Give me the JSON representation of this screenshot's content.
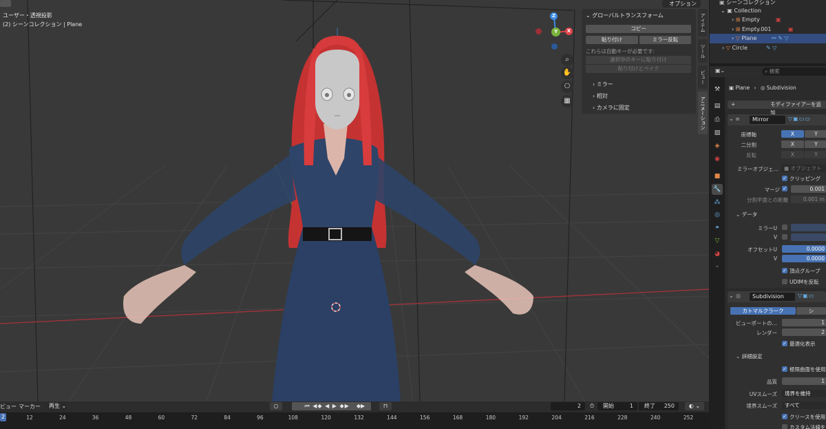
{
  "viewport": {
    "view_mode": "ユーザー・透視投影",
    "collection_info": "(2) シーンコレクション | Plane",
    "options_label": "オプション",
    "gizmo": {
      "z": "Z",
      "y": "Y",
      "x": "X"
    }
  },
  "npanel": {
    "title": "グローバルトランスフォーム",
    "copy": "コピー",
    "paste": "貼り付け",
    "mirror_flip": "ミラー反転",
    "auto_key_note": "これらは自動キーが必要です:",
    "paste_selected": "選択中のキーに貼り付け",
    "paste_bake": "貼り付けとベイク",
    "sub_mirror": "ミラー",
    "sub_relative": "相対",
    "sub_camera": "カメラに固定",
    "tabs": [
      "アイテム",
      "ツール",
      "ビュー",
      "アニメーション"
    ]
  },
  "timeline": {
    "menu_view": "ビュー",
    "menu_marker": "マーカー",
    "menu_play": "再生",
    "current_frame": "2",
    "start_label": "開始",
    "start_value": "1",
    "end_label": "終了",
    "end_value": "250",
    "cursor_label": "2",
    "ticks": [
      "12",
      "24",
      "36",
      "48",
      "60",
      "72",
      "84",
      "96",
      "108",
      "120",
      "132",
      "144",
      "156",
      "168",
      "180",
      "192",
      "204",
      "216",
      "228",
      "240",
      "252"
    ]
  },
  "outliner": {
    "root": "シーンコレクション",
    "collection": "Collection",
    "items": [
      "Empty",
      "Empty.001",
      "Plane",
      "Circle"
    ]
  },
  "properties": {
    "search_placeholder": "検索",
    "breadcrumb_object": "Plane",
    "breadcrumb_modifier": "Subdivision",
    "add_modifier": "モディファイアーを追加",
    "mirror": {
      "name": "Mirror",
      "axis_label": "座標軸",
      "bisect_label": "二分割",
      "flip_label": "反転",
      "x": "X",
      "y": "Y",
      "mirror_object_label": "ミラーオブジェ…",
      "mirror_object_placeholder": "オブジェクト",
      "clipping": "クリッピング",
      "merge_label": "マージ",
      "merge_value": "0.001",
      "bisect_distance_label": "分割平面との距離",
      "bisect_distance_value": "0.001 m",
      "data_label": "データ",
      "mirror_u": "ミラーU",
      "v": "V",
      "offset_u": "オフセットU",
      "offset_u_value": "0.0000",
      "offset_v_value": "0.0000",
      "vertex_groups": "頂点グループ",
      "udim_flip": "UDIMを反転"
    },
    "subdivision": {
      "name": "Subdivision",
      "catmull": "カトマルクラーク",
      "simple": "シ",
      "viewport_label": "ビューポートの…",
      "viewport_value": "1",
      "render_label": "レンダー",
      "render_value": "2",
      "optimal_display": "最適化表示",
      "advanced": "詳細設定",
      "limit_surface": "極限曲面を使用",
      "quality_label": "品質",
      "quality_value": "1",
      "uv_smooth_label": "UVスムーズ",
      "uv_smooth_value": "境界を維持",
      "boundary_smooth_label": "境界スムーズ",
      "boundary_smooth_value": "すべて",
      "use_creases": "クリースを使用",
      "custom_normals": "カスタム法線を"
    }
  },
  "colors": {
    "viewport_bg": "#393939",
    "accent": "#4772b3",
    "hair": "#d23a3a",
    "dress": "#2e4468",
    "skin": "#e8c4b8",
    "axis_x": "#e0424a",
    "axis_y": "#7ab43c",
    "axis_z": "#3c8ae0"
  }
}
